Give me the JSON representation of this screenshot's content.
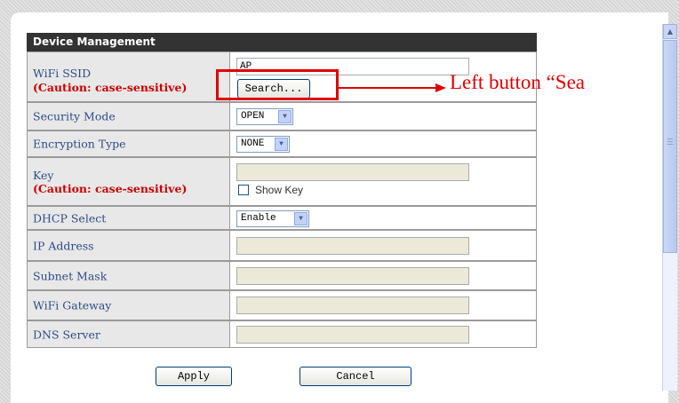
{
  "panel": {
    "title": "Device Management"
  },
  "fields": {
    "wifi_ssid": {
      "label": "WiFi SSID",
      "caution": "(Caution: case-sensitive)",
      "value": "AP",
      "search_button": "Search..."
    },
    "security_mode": {
      "label": "Security Mode",
      "selected": "OPEN"
    },
    "encryption_type": {
      "label": "Encryption Type",
      "selected": "NONE"
    },
    "key": {
      "label": "Key",
      "caution": "(Caution: case-sensitive)",
      "value": "",
      "show_key_label": "Show Key",
      "show_key_checked": false
    },
    "dhcp_select": {
      "label": "DHCP Select",
      "selected": "Enable"
    },
    "ip_address": {
      "label": "IP Address",
      "value": ""
    },
    "subnet_mask": {
      "label": "Subnet Mask",
      "value": ""
    },
    "wifi_gateway": {
      "label": "WiFi Gateway",
      "value": ""
    },
    "dns_server": {
      "label": "DNS Server",
      "value": ""
    }
  },
  "buttons": {
    "apply": "Apply",
    "cancel": "Cancel"
  },
  "annotation": {
    "text": "Left button “Sea",
    "color": "#e00000"
  },
  "icons": {
    "dropdown": "chevron-down-icon",
    "scroll_up": "scroll-up-arrow-icon"
  }
}
